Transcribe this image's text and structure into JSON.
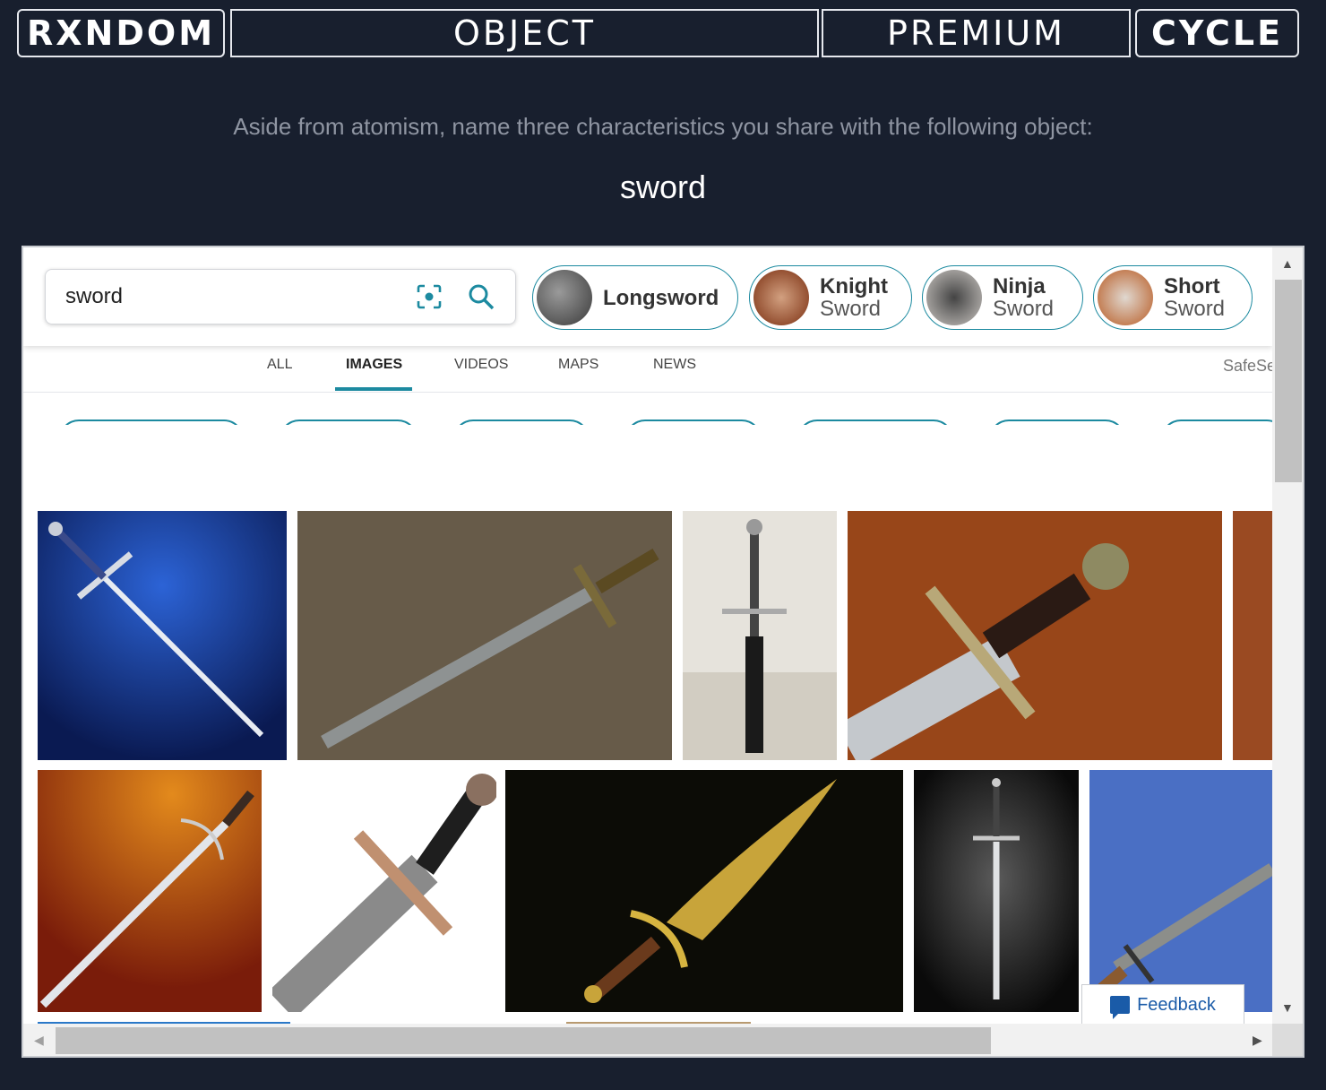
{
  "nav": {
    "random": "RXNDOM",
    "object": "OBJECT",
    "premium": "PREMIUM",
    "cycle": "CYCLE"
  },
  "prompt": "Aside from atomism, name three characteristics you share with the following object:",
  "object_word": "sword",
  "search": {
    "query": "sword",
    "visual_search_icon": "camera-scan-icon",
    "search_icon": "magnifier-icon"
  },
  "suggestions": [
    {
      "line1": "Longsword",
      "line2": ""
    },
    {
      "line1": "Knight",
      "line2": "Sword"
    },
    {
      "line1": "Ninja",
      "line2": "Sword"
    },
    {
      "line1": "Short",
      "line2": "Sword"
    }
  ],
  "tabs": [
    {
      "label": "ALL",
      "active": false
    },
    {
      "label": "IMAGES",
      "active": true
    },
    {
      "label": "VIDEOS",
      "active": false
    },
    {
      "label": "MAPS",
      "active": false
    },
    {
      "label": "NEWS",
      "active": false
    }
  ],
  "safesearch": "SafeSe",
  "feedback": "Feedback",
  "colors": {
    "page_bg": "#181f2e",
    "accent": "#1c8aa0",
    "link": "#1a5ba8"
  }
}
